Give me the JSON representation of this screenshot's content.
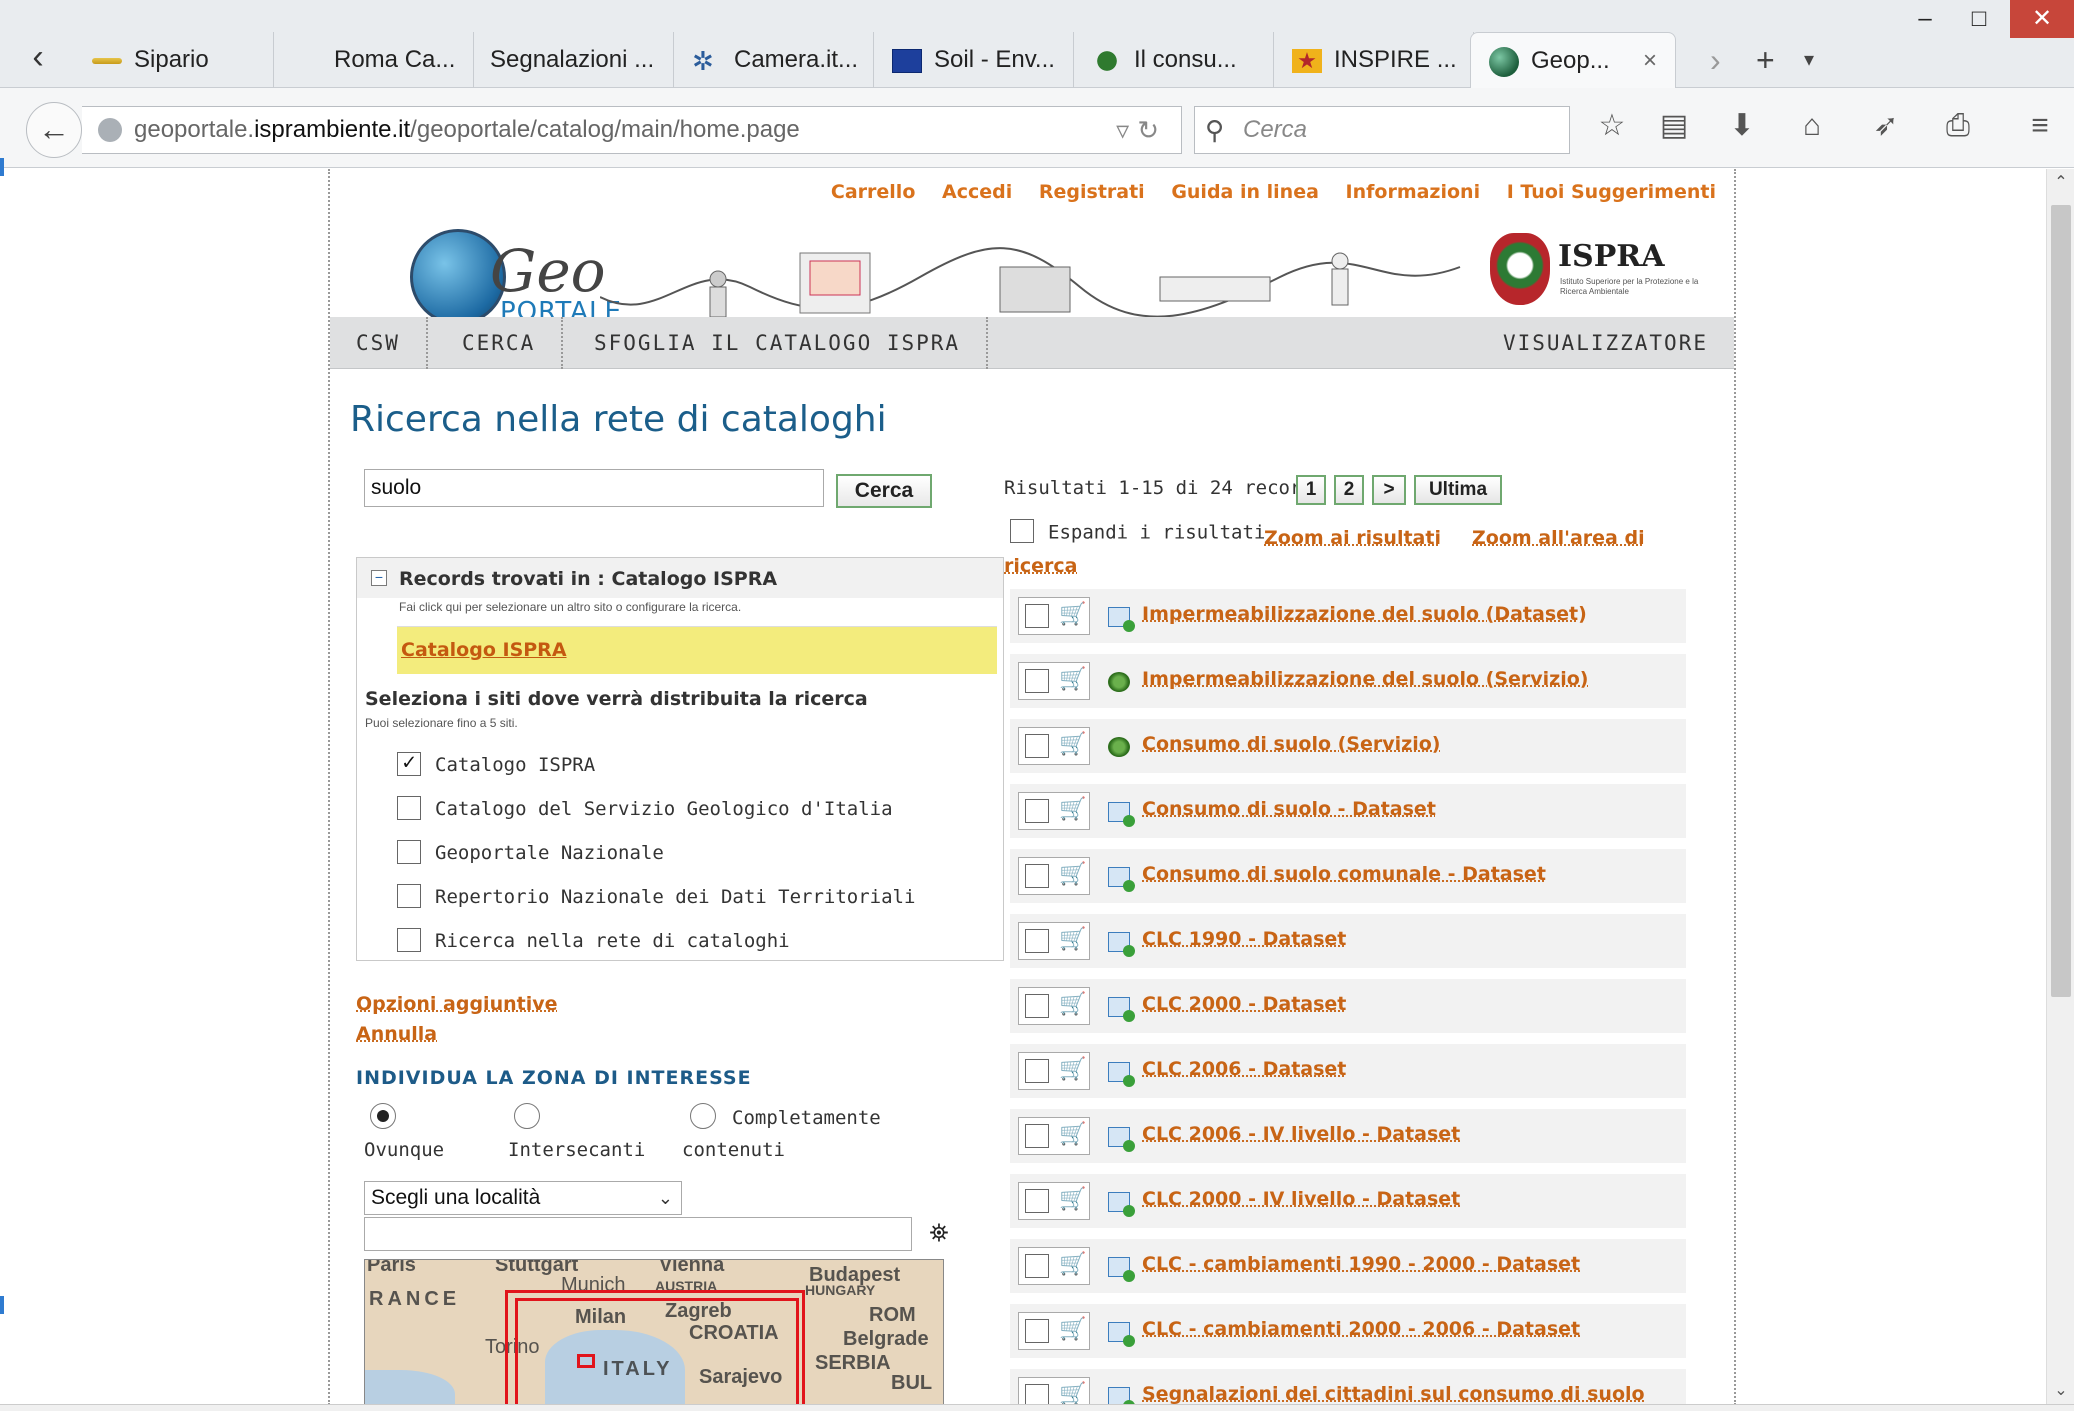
{
  "browser": {
    "tabs": [
      {
        "label": "Sipario",
        "icon": "sipario-icon"
      },
      {
        "label": "Roma Ca...",
        "icon": ""
      },
      {
        "label": "Segnalazioni ...",
        "icon": ""
      },
      {
        "label": "Camera.it...",
        "icon": "camera-icon"
      },
      {
        "label": "Soil - Env...",
        "icon": "eu-flag-icon"
      },
      {
        "label": "Il consu...",
        "icon": "leaf-icon"
      },
      {
        "label": "INSPIRE ...",
        "icon": "inspire-icon"
      },
      {
        "label": "Geop...",
        "icon": "globe-icon"
      }
    ],
    "active_tab_close": "×",
    "url_prefix": "geoportale.",
    "url_domain": "isprambiente.it",
    "url_path": "/geoportale/catalog/main/home.page",
    "search_placeholder": "Cerca",
    "colors": {
      "close_button": "#c7463a",
      "accent_link": "#c86415",
      "title_blue": "#1b5e8a"
    }
  },
  "header": {
    "top_links": [
      "Carrello",
      "Accedi",
      "Registrati",
      "Guida in linea",
      "Informazioni",
      "I Tuoi Suggerimenti"
    ],
    "logo_geo": "Geo",
    "logo_portale": "PORTALE",
    "ispra_name": "ISPRA",
    "ispra_sub": "Istituto Superiore per la Protezione e la Ricerca Ambientale"
  },
  "nav": {
    "left": [
      "CSW",
      "CERCA",
      "SFOGLIA IL CATALOGO ISPRA"
    ],
    "right": "VISUALIZZATORE"
  },
  "main": {
    "title": "Ricerca nella rete di cataloghi",
    "search_value": "suolo",
    "search_button": "Cerca",
    "records_title": "Records trovati in : Catalogo ISPRA",
    "records_hint": "Fai click qui per selezionare un altro sito o configurare la ricerca.",
    "records_catalog": "Catalogo ISPRA",
    "select_title": "Seleziona i siti dove verrà distribuita la ricerca",
    "select_hint": "Puoi selezionare fino a 5 siti.",
    "sites": [
      {
        "label": "Catalogo ISPRA",
        "checked": true
      },
      {
        "label": "Catalogo del Servizio Geologico d'Italia",
        "checked": false
      },
      {
        "label": "Geoportale Nazionale",
        "checked": false
      },
      {
        "label": "Repertorio Nazionale dei Dati Territoriali",
        "checked": false
      },
      {
        "label": "Ricerca nella rete di cataloghi",
        "checked": false
      }
    ],
    "options_link": "Opzioni aggiuntive",
    "cancel_link": "Annulla",
    "zone_title": "INDIVIDUA LA ZONA DI INTERESSE",
    "zone_options": [
      {
        "label": "Ovunque",
        "selected": true
      },
      {
        "label": "Intersecanti",
        "selected": false
      },
      {
        "label_line1": "Completamente",
        "label_line2": "contenuti",
        "selected": false
      }
    ],
    "location_select": "Scegli una località",
    "map_labels": [
      "Paris",
      "Stuttgart",
      "Vienna",
      "Budapest",
      "RANCE",
      "Munich",
      "AUSTRIA",
      "HUNGARY",
      "Milan",
      "Zagreb",
      "ROM",
      "Torino",
      "CROATIA",
      "Belgrade",
      "ITALY",
      "Sarajevo",
      "SERBIA",
      "BUL"
    ]
  },
  "results": {
    "info": "Risultati 1-15 di 24 record",
    "pages": [
      "1",
      "2",
      ">",
      "Ultima"
    ],
    "expand_label": "Espandi i risultati",
    "zoom_results": "Zoom ai risultati",
    "zoom_area_1": "Zoom all'area di",
    "zoom_area_2": "ricerca",
    "items": [
      {
        "title": "Impermeabilizzazione del suolo (Dataset)",
        "kind": "dataset"
      },
      {
        "title": "Impermeabilizzazione del suolo (Servizio)",
        "kind": "service"
      },
      {
        "title": "Consumo di suolo (Servizio)",
        "kind": "service"
      },
      {
        "title": "Consumo di suolo - Dataset",
        "kind": "dataset"
      },
      {
        "title": "Consumo di suolo comunale - Dataset",
        "kind": "dataset"
      },
      {
        "title": "CLC 1990 - Dataset",
        "kind": "dataset"
      },
      {
        "title": "CLC 2000 - Dataset",
        "kind": "dataset"
      },
      {
        "title": "CLC 2006 - Dataset",
        "kind": "dataset"
      },
      {
        "title": "CLC 2006 - IV livello - Dataset",
        "kind": "dataset"
      },
      {
        "title": "CLC 2000 - IV livello - Dataset",
        "kind": "dataset"
      },
      {
        "title": "CLC - cambiamenti 1990 - 2000 - Dataset",
        "kind": "dataset"
      },
      {
        "title": "CLC - cambiamenti 2000 - 2006 - Dataset",
        "kind": "dataset"
      },
      {
        "title": "Segnalazioni dei cittadini sul consumo di suolo",
        "kind": "dataset"
      }
    ]
  }
}
